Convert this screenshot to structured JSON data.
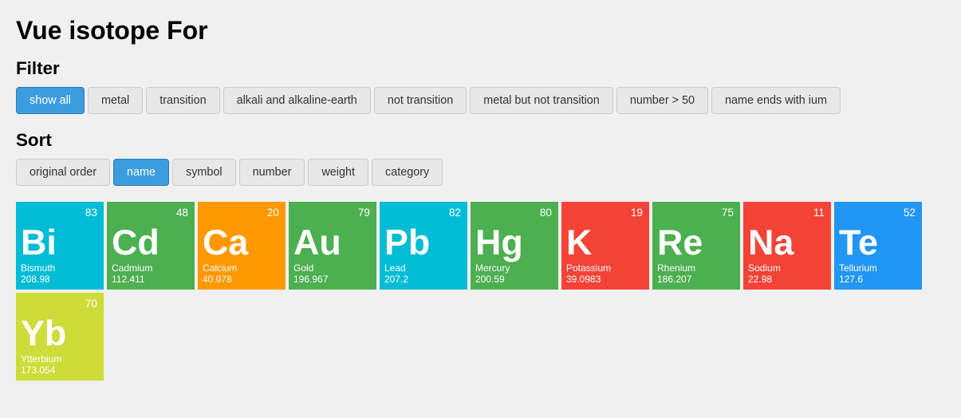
{
  "title": "Vue isotope For",
  "filter": {
    "label": "Filter",
    "buttons": [
      {
        "id": "show-all",
        "label": "show all",
        "active": true
      },
      {
        "id": "metal",
        "label": "metal",
        "active": false
      },
      {
        "id": "transition",
        "label": "transition",
        "active": false
      },
      {
        "id": "alkali",
        "label": "alkali and alkaline-earth",
        "active": false
      },
      {
        "id": "not-transition",
        "label": "not transition",
        "active": false
      },
      {
        "id": "metal-not-transition",
        "label": "metal but not transition",
        "active": false
      },
      {
        "id": "number-gt-50",
        "label": "number > 50",
        "active": false
      },
      {
        "id": "name-ends-ium",
        "label": "name ends with ium",
        "active": false
      }
    ]
  },
  "sort": {
    "label": "Sort",
    "buttons": [
      {
        "id": "original-order",
        "label": "original order",
        "active": false
      },
      {
        "id": "name",
        "label": "name",
        "active": true
      },
      {
        "id": "symbol",
        "label": "symbol",
        "active": false
      },
      {
        "id": "number",
        "label": "number",
        "active": false
      },
      {
        "id": "weight",
        "label": "weight",
        "active": false
      },
      {
        "id": "category",
        "label": "category",
        "active": false
      }
    ]
  },
  "elements": [
    {
      "symbol": "Bi",
      "number": 83,
      "name": "Bismuth",
      "weight": "208.98",
      "color": "#00bcd4"
    },
    {
      "symbol": "Cd",
      "number": 48,
      "name": "Cadmium",
      "weight": "112.411",
      "color": "#4caf50"
    },
    {
      "symbol": "Ca",
      "number": 20,
      "name": "Calcium",
      "weight": "40.078",
      "color": "#ff9800"
    },
    {
      "symbol": "Au",
      "number": 79,
      "name": "Gold",
      "weight": "196.967",
      "color": "#4caf50"
    },
    {
      "symbol": "Pb",
      "number": 82,
      "name": "Lead",
      "weight": "207.2",
      "color": "#00bcd4"
    },
    {
      "symbol": "Hg",
      "number": 80,
      "name": "Mercury",
      "weight": "200.59",
      "color": "#4caf50"
    },
    {
      "symbol": "K",
      "number": 19,
      "name": "Potassium",
      "weight": "39.0983",
      "color": "#f44336"
    },
    {
      "symbol": "Re",
      "number": 75,
      "name": "Rhenium",
      "weight": "186.207",
      "color": "#4caf50"
    },
    {
      "symbol": "Na",
      "number": 11,
      "name": "Sodium",
      "weight": "22.98",
      "color": "#f44336"
    },
    {
      "symbol": "Te",
      "number": 52,
      "name": "Tellurium",
      "weight": "127.6",
      "color": "#2196f3"
    },
    {
      "symbol": "Yb",
      "number": 70,
      "name": "Ytterbium",
      "weight": "173.054",
      "color": "#cddc39"
    }
  ]
}
